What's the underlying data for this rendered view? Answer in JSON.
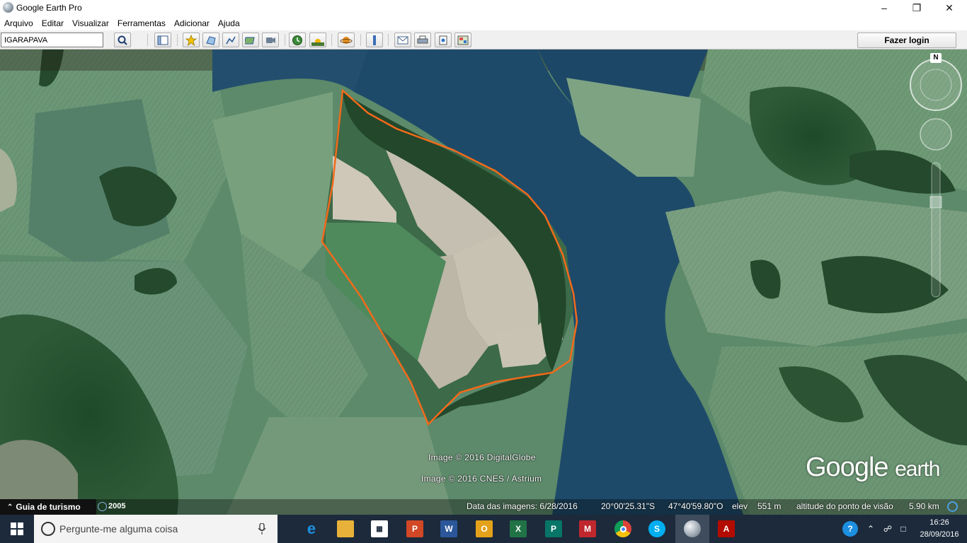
{
  "window": {
    "title": "Google Earth Pro"
  },
  "menu": [
    "Arquivo",
    "Editar",
    "Visualizar",
    "Ferramentas",
    "Adicionar",
    "Ajuda"
  ],
  "search": {
    "value": "IGARAPAVA"
  },
  "toolbar": {
    "login_label": "Fazer login",
    "buttons": [
      "sidebar-toggle-icon",
      "placemark-icon",
      "polygon-icon",
      "path-icon",
      "image-overlay-icon",
      "record-tour-icon",
      "historical-imagery-icon",
      "sunlight-icon",
      "planets-icon",
      "ruler-icon",
      "email-icon",
      "print-icon",
      "save-image-icon",
      "view-in-maps-icon"
    ]
  },
  "map": {
    "compass_label": "N",
    "attribution_1": "Image © 2016 DigitalGlobe",
    "attribution_2": "Image © 2016 CNES / Astrium",
    "logo": {
      "word1": "Google",
      "word2": "earth"
    },
    "polygon_color": "#f26a1b"
  },
  "status": {
    "tour_guide": "Guia de turismo",
    "historical_year": "2005",
    "imagery_date": "Data das imagens: 6/28/2016",
    "lat": "20°00'25.31\"S",
    "lon": "47°40'59.80\"O",
    "elev_label": "elev",
    "elev_value": "551 m",
    "eye_alt_label": "altitude do ponto de visão",
    "eye_alt_value": "5.90 km"
  },
  "taskbar": {
    "search_placeholder": "Pergunte-me alguma coisa",
    "apps": [
      "edge-icon",
      "file-explorer-icon",
      "store-icon",
      "powerpoint-icon",
      "word-icon",
      "outlook-icon",
      "excel-icon",
      "publisher-icon",
      "media-app-icon",
      "chrome-icon",
      "skype-icon",
      "google-earth-icon",
      "acrobat-icon"
    ],
    "time": "16:26",
    "date": "28/09/2016"
  }
}
